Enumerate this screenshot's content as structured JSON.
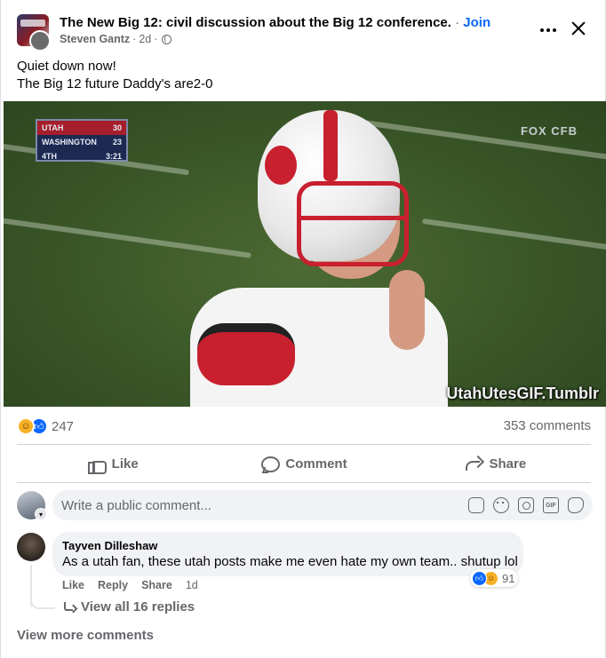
{
  "post": {
    "group_name": "The New Big 12: civil discussion about the Big 12 conference.",
    "separator": "·",
    "join_label": "Join",
    "author": "Steven Gantz",
    "time": "2d",
    "time_separator": "·",
    "text_line1": "Quiet down now!",
    "text_line2": "The Big 12 future Daddy's are2-0"
  },
  "media": {
    "watermark": "UtahUtesGIF.Tumblr",
    "scorebug_row1_team": "UTAH",
    "scorebug_row1_score": "30",
    "scorebug_row2_team": "WASHINGTON",
    "scorebug_row2_score": "23",
    "scorebug_row3_quarter": "4TH",
    "scorebug_row3_clock": "3:21",
    "network": "FOX CFB"
  },
  "stats": {
    "reaction_count": "247",
    "comments_count": "353 comments",
    "reaction_icons": [
      "haha-icon",
      "like-icon"
    ]
  },
  "actions": {
    "like_label": "Like",
    "comment_label": "Comment",
    "share_label": "Share"
  },
  "composer": {
    "placeholder": "Write a public comment...",
    "tool_icons": [
      "sticker-icon",
      "emoji-icon",
      "camera-icon",
      "gif-icon",
      "avatar-sticker-icon"
    ],
    "gif_label": "GIF"
  },
  "comment": {
    "author": "Tayven Dilleshaw",
    "text": "As a utah fan, these utah posts make me even hate my own team.. shutup lol",
    "reaction_count": "91",
    "like_label": "Like",
    "reply_label": "Reply",
    "share_label": "Share",
    "time": "1d",
    "view_replies": "View all 16 replies"
  },
  "footer": {
    "view_more": "View more comments"
  },
  "colors": {
    "accent": "#0866ff",
    "secondary_text": "#65676b",
    "comment_bubble": "#f0f2f5",
    "utah_red": "#c8202f"
  }
}
